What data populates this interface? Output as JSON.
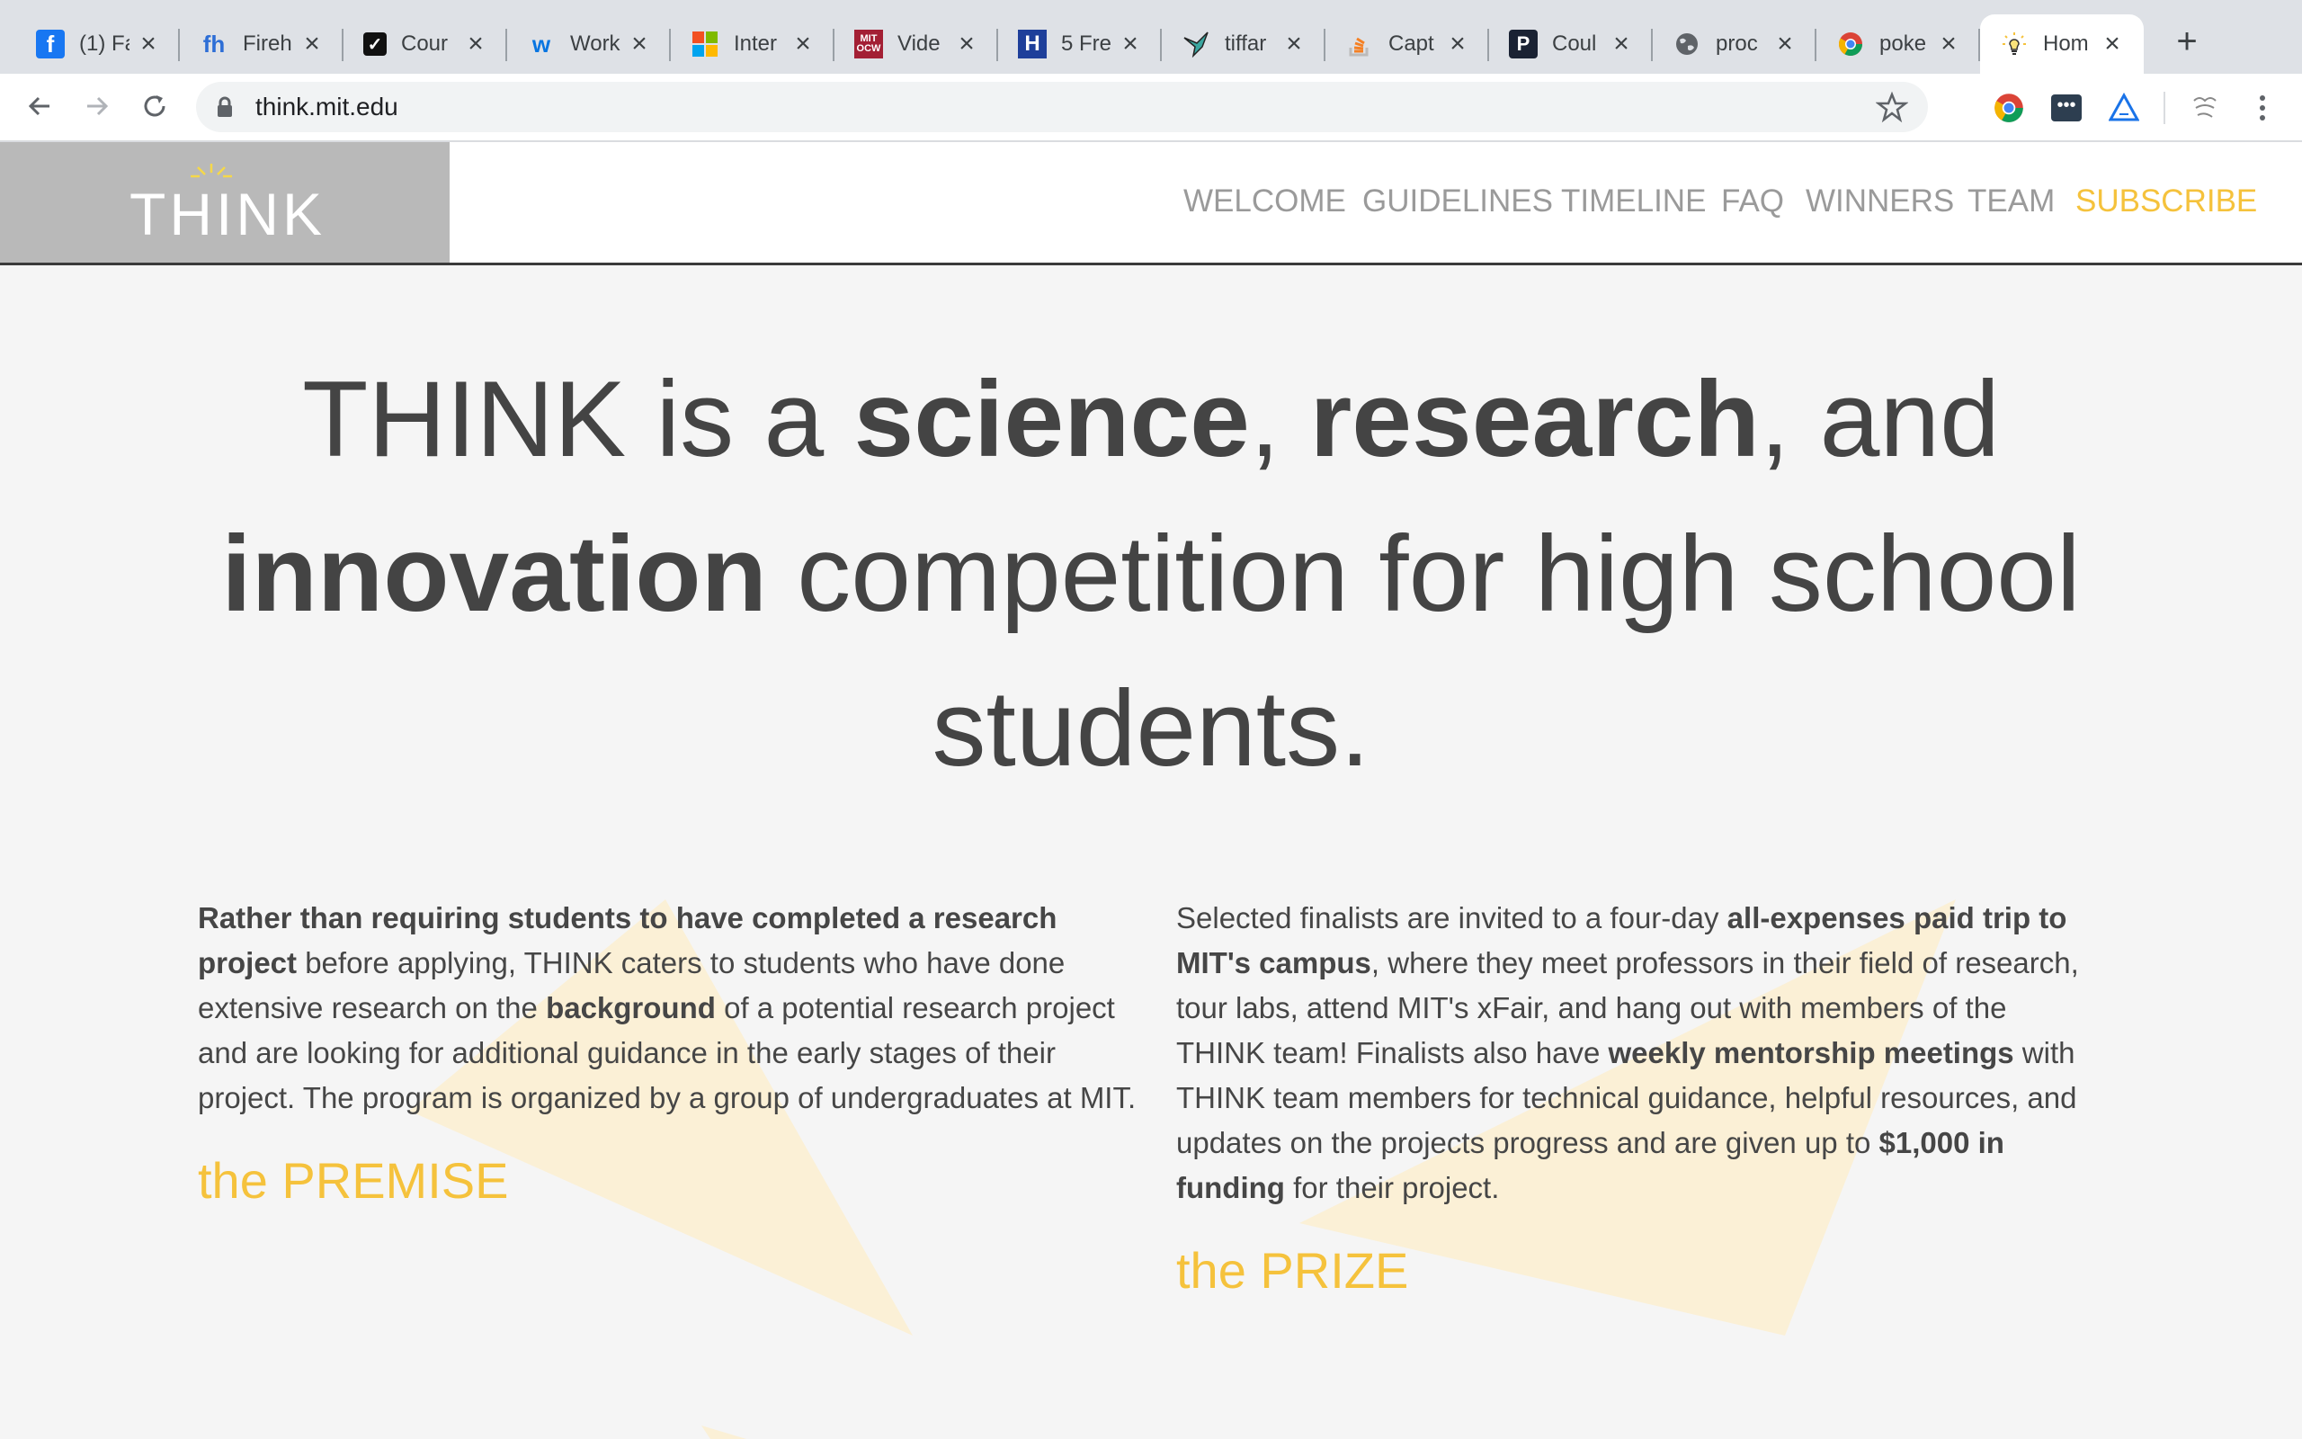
{
  "browser": {
    "tabs": [
      {
        "title": "(1) Fa",
        "icon": "facebook-icon",
        "active": false
      },
      {
        "title": "Fireh",
        "icon": "firehouse-fh-icon",
        "active": false
      },
      {
        "title": "Cour",
        "icon": "checkbox-check-icon",
        "active": false
      },
      {
        "title": "Work",
        "icon": "workday-w-icon",
        "active": false
      },
      {
        "title": "Inter",
        "icon": "microsoft-icon",
        "active": false
      },
      {
        "title": "Vide",
        "icon": "mit-ocw-icon",
        "active": false
      },
      {
        "title": "5 Fre",
        "icon": "h-logo-icon",
        "active": false
      },
      {
        "title": "tiffar",
        "icon": "bird-icon",
        "active": false
      },
      {
        "title": "Capt",
        "icon": "stackoverflow-icon",
        "active": false
      },
      {
        "title": "Coul",
        "icon": "p-logo-icon",
        "active": false
      },
      {
        "title": "proc",
        "icon": "globe-icon",
        "active": false
      },
      {
        "title": "poke",
        "icon": "chrome-icon",
        "active": false
      },
      {
        "title": "Hom",
        "icon": "lightbulb-icon",
        "active": true
      }
    ],
    "url": "think.mit.edu"
  },
  "site": {
    "logo": "THINK",
    "nav": [
      "WELCOME",
      "GUIDELINES",
      "TIMELINE",
      "FAQ",
      "WINNERS",
      "TEAM",
      "SUBSCRIBE"
    ],
    "hero": {
      "p1": "THINK is a ",
      "b1": "science",
      "p2": ", ",
      "b2": "research",
      "p3": ", and ",
      "b3": "innovation",
      "p4": " competition for high school students."
    },
    "premise": {
      "b1": "Rather than requiring students to have completed a research project",
      "t1": " before applying, THINK caters to students who have done extensive research on the ",
      "b2": "background",
      "t2": " of a potential research project and are looking for additional guidance in the early stages of their project. The program is organized by a group of undergraduates at MIT.",
      "title": "the PREMISE"
    },
    "prize": {
      "t1": "Selected finalists are invited to a four-day ",
      "b1": "all-expenses paid trip to MIT's campus",
      "t2": ", where they meet professors in their field of research, tour labs, attend MIT's xFair, and hang out with members of the THINK team! Finalists also have ",
      "b2": "weekly mentorship meetings",
      "t3": " with THINK team members for technical guidance, helpful resources, and updates on the projects progress and are given up to ",
      "b3": "$1,000 in funding",
      "t4": " for their project.",
      "title": "the PRIZE"
    }
  },
  "colors": {
    "accent": "#f5c23c",
    "text": "#444444",
    "logo_bg": "#b9b9b9",
    "page_bg": "#f5f5f5"
  }
}
